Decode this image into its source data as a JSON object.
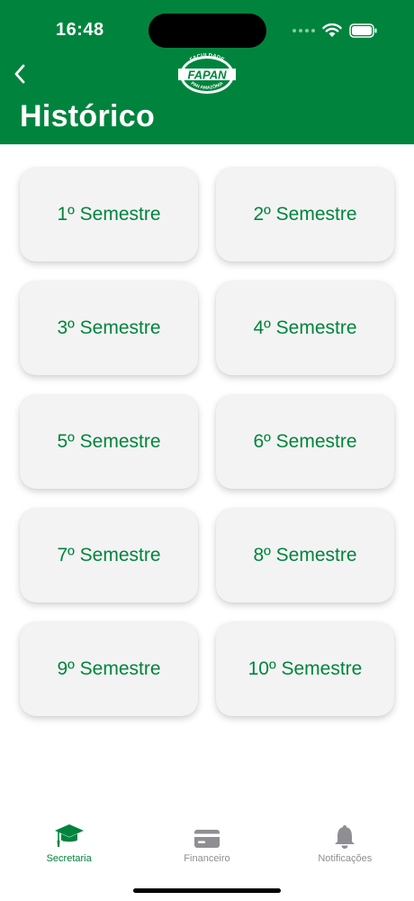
{
  "status_bar": {
    "time": "16:48"
  },
  "header": {
    "title": "Histórico",
    "logo": {
      "main": "FAPAN",
      "arc_top": "FACULDADE",
      "arc_bottom": "PAN AMAZÔNIA"
    }
  },
  "semesters": [
    "1º Semestre",
    "2º Semestre",
    "3º Semestre",
    "4º Semestre",
    "5º Semestre",
    "6º Semestre",
    "7º Semestre",
    "8º Semestre",
    "9º Semestre",
    "10º Semestre"
  ],
  "tabs": [
    {
      "label": "Secretaria",
      "icon": "graduation-cap-icon",
      "active": true
    },
    {
      "label": "Financeiro",
      "icon": "credit-card-icon",
      "active": false
    },
    {
      "label": "Notificações",
      "icon": "bell-icon",
      "active": false
    }
  ],
  "colors": {
    "brand": "#00843d",
    "card": "#f3f3f3",
    "inactive": "#8e8e93"
  }
}
